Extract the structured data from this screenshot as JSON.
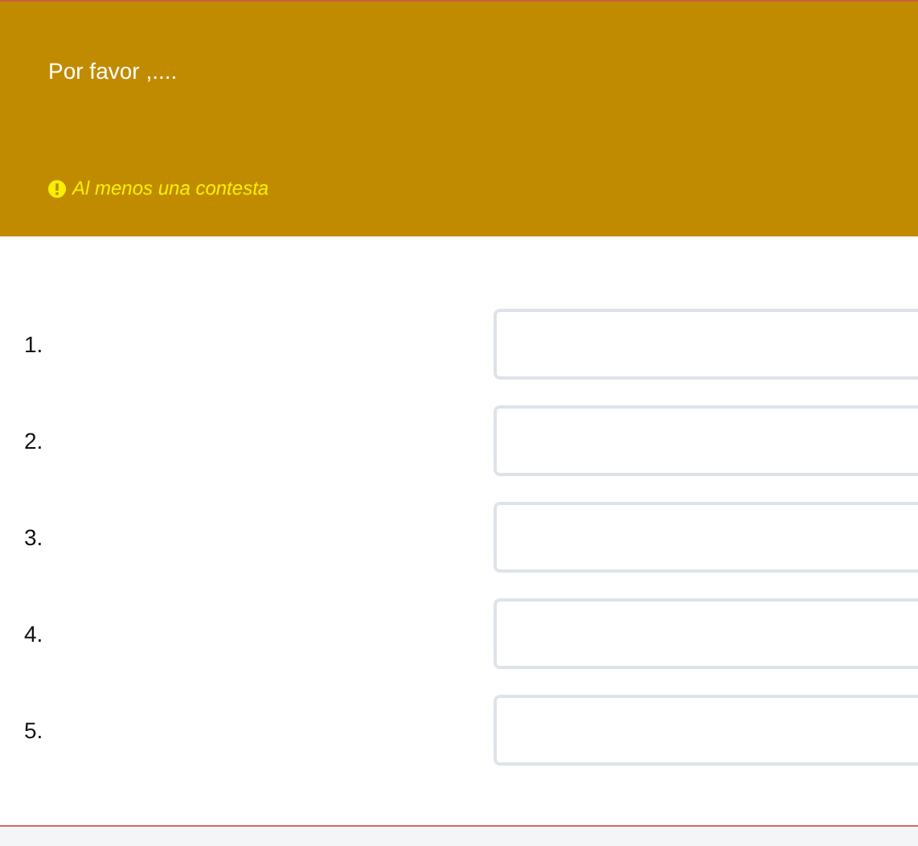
{
  "header": {
    "title": "Por favor ,....",
    "warning": "Al menos una contesta"
  },
  "answers": [
    {
      "number": "1."
    },
    {
      "number": "2."
    },
    {
      "number": "3."
    },
    {
      "number": "4."
    },
    {
      "number": "5."
    }
  ]
}
